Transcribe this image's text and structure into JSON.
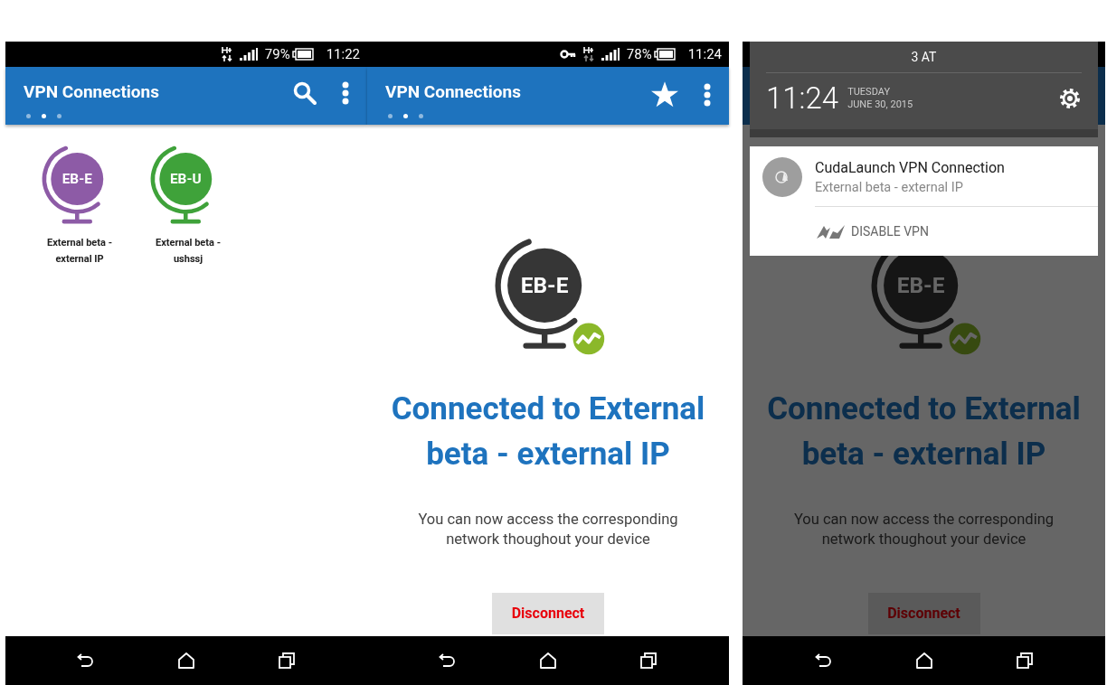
{
  "screens": [
    {
      "kind": "list",
      "status_bar": {
        "vpn_key": false,
        "battery": "79%",
        "time": "11:22"
      },
      "app_bar": {
        "title": "VPN Connections",
        "pages": [
          {
            "selected": false
          },
          {
            "selected": true
          },
          {
            "selected": false
          }
        ]
      },
      "connections": [
        {
          "initials": "EB-E",
          "label": "External beta - external IP",
          "color": "#8d5ba6"
        },
        {
          "initials": "EB-U",
          "label": "External beta - ushssj",
          "color": "#3fa23a"
        }
      ]
    },
    {
      "kind": "connected",
      "status_bar": {
        "vpn_key": true,
        "battery": "78%",
        "time": "11:24"
      },
      "app_bar": {
        "title": "VPN Connections",
        "pages": [
          {
            "selected": false
          },
          {
            "selected": true
          },
          {
            "selected": false
          }
        ]
      },
      "globe_initials": "EB-E",
      "heading": "Connected to External beta - external IP",
      "message": "You can now access the corresponding network thoughout your device",
      "button": "Disconnect"
    },
    {
      "kind": "shade",
      "shade": {
        "carrier": "3 AT",
        "time": "11:24",
        "day": "TUESDAY",
        "date": "JUNE 30, 2015"
      },
      "notification": {
        "title": "CudaLaunch VPN Connection",
        "text": "External beta - external IP",
        "action": "DISABLE VPN"
      },
      "globe_initials": "EB-E",
      "heading": "Connected to External beta - external IP",
      "message": "You can now access the corresponding network thoughout your device",
      "button": "Disconnect"
    }
  ]
}
